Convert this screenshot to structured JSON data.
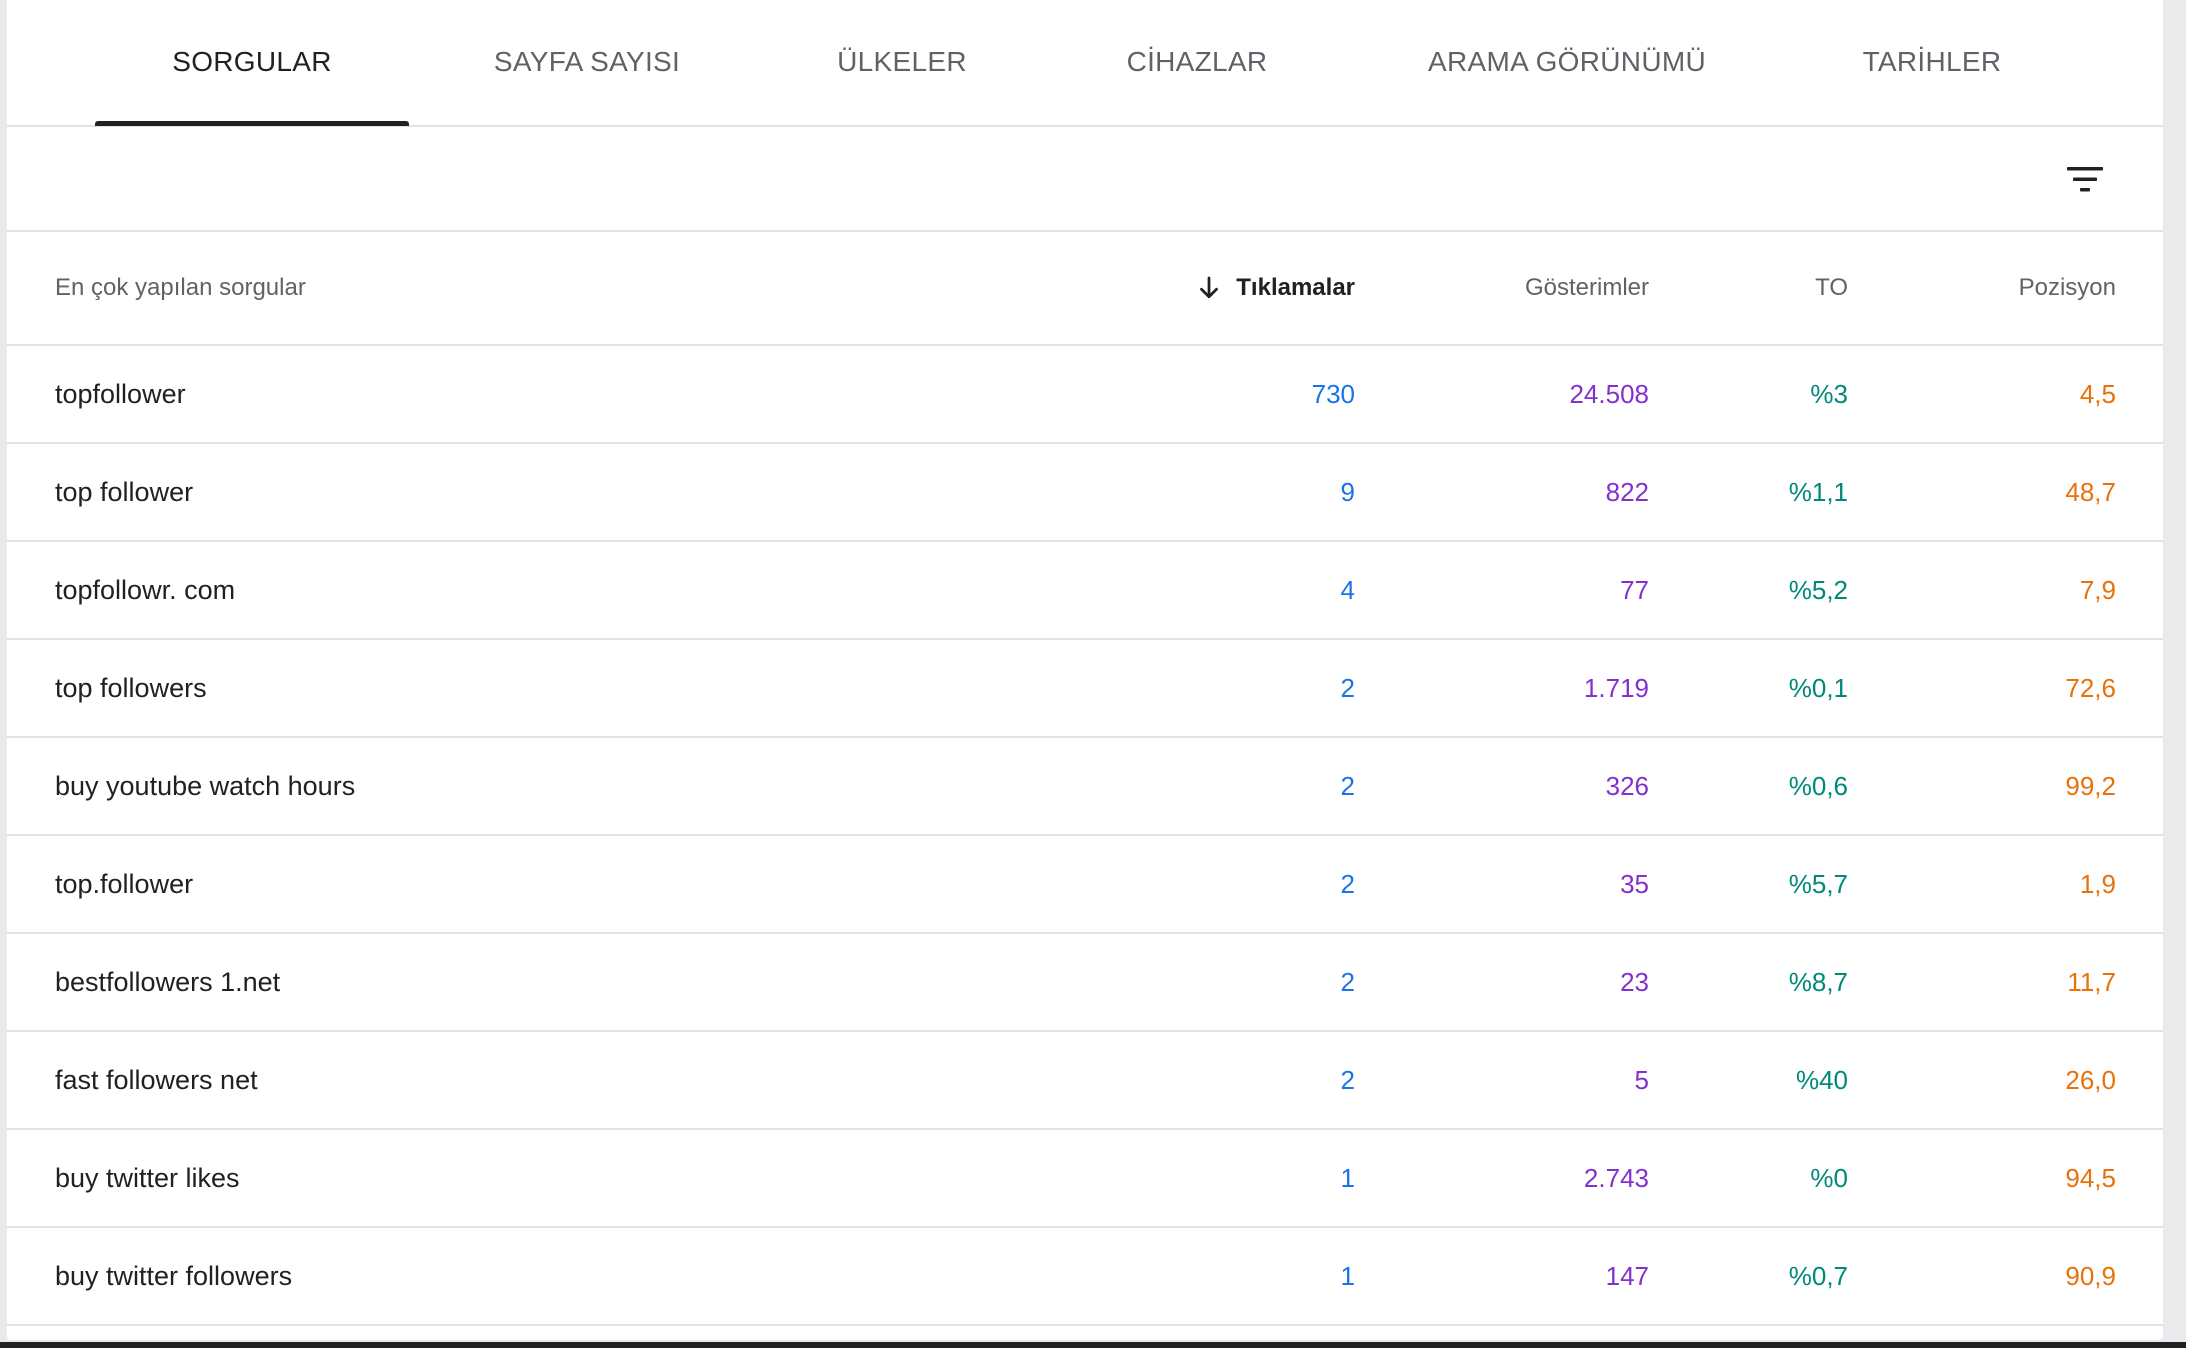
{
  "tabs": [
    {
      "label": "SORGULAR",
      "active": true
    },
    {
      "label": "SAYFA SAYISI",
      "active": false
    },
    {
      "label": "ÜLKELER",
      "active": false
    },
    {
      "label": "CİHAZLAR",
      "active": false
    },
    {
      "label": "ARAMA GÖRÜNÜMÜ",
      "active": false
    },
    {
      "label": "TARİHLER",
      "active": false
    }
  ],
  "toolbar": {
    "filter_icon": "filter-icon"
  },
  "table": {
    "headers": {
      "query": "En çok yapılan sorgular",
      "clicks": "Tıklamalar",
      "impressions": "Gösterimler",
      "ctr": "TO",
      "position": "Pozisyon"
    },
    "sort_icon": "arrow-down-icon",
    "rows": [
      {
        "query": "topfollower",
        "clicks": "730",
        "impressions": "24.508",
        "ctr": "%3",
        "position": "4,5"
      },
      {
        "query": "top follower",
        "clicks": "9",
        "impressions": "822",
        "ctr": "%1,1",
        "position": "48,7"
      },
      {
        "query": "topfollowr. com",
        "clicks": "4",
        "impressions": "77",
        "ctr": "%5,2",
        "position": "7,9"
      },
      {
        "query": "top followers",
        "clicks": "2",
        "impressions": "1.719",
        "ctr": "%0,1",
        "position": "72,6"
      },
      {
        "query": "buy youtube watch hours",
        "clicks": "2",
        "impressions": "326",
        "ctr": "%0,6",
        "position": "99,2"
      },
      {
        "query": "top.follower",
        "clicks": "2",
        "impressions": "35",
        "ctr": "%5,7",
        "position": "1,9"
      },
      {
        "query": "bestfollowers 1.net",
        "clicks": "2",
        "impressions": "23",
        "ctr": "%8,7",
        "position": "11,7"
      },
      {
        "query": "fast followers net",
        "clicks": "2",
        "impressions": "5",
        "ctr": "%40",
        "position": "26,0"
      },
      {
        "query": "buy twitter likes",
        "clicks": "1",
        "impressions": "2.743",
        "ctr": "%0",
        "position": "94,5"
      },
      {
        "query": "buy twitter followers",
        "clicks": "1",
        "impressions": "147",
        "ctr": "%0,7",
        "position": "90,9"
      }
    ]
  },
  "colors": {
    "clicks": "#1a73e8",
    "impressions": "#8430ce",
    "ctr": "#00897b",
    "position": "#e8710a"
  }
}
